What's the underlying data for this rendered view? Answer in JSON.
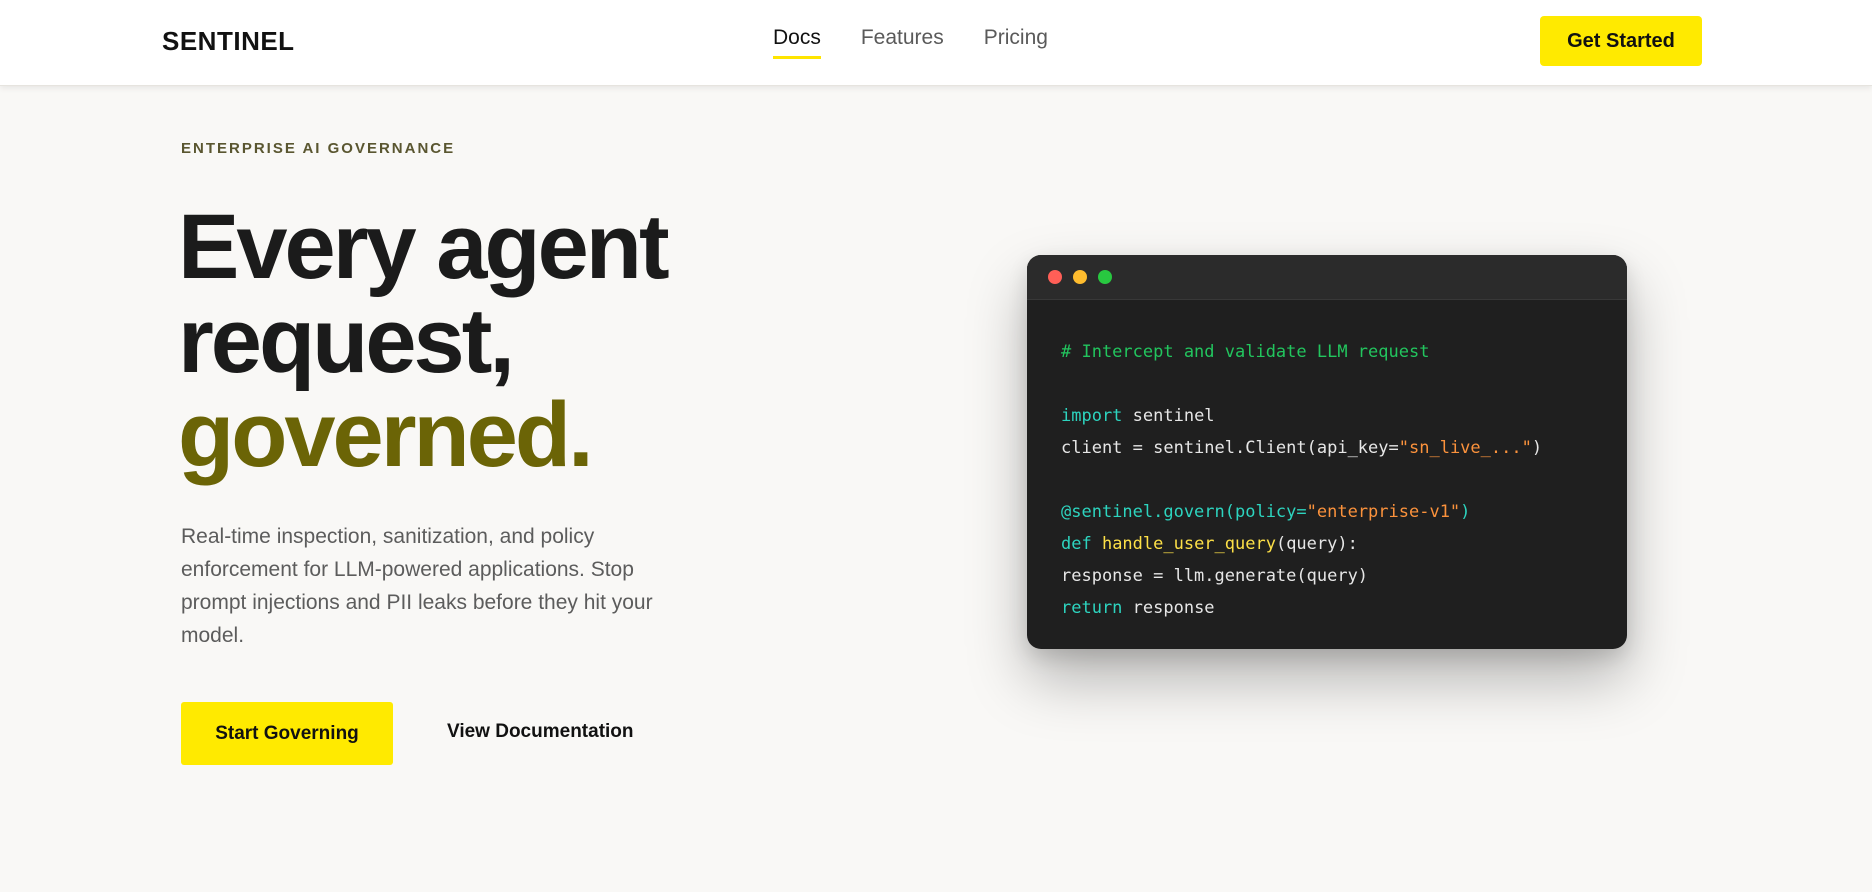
{
  "nav": {
    "brand": "SENTINEL",
    "links": [
      "Docs",
      "Features",
      "Pricing"
    ],
    "cta": "Get Started"
  },
  "hero": {
    "eyebrow": "ENTERPRISE AI GOVERNANCE",
    "headline_line1": "Every agent",
    "headline_line2": "request,",
    "headline_accent": "governed.",
    "subcopy": "Real-time inspection, sanitization, and policy enforcement for LLM-powered applications. Stop prompt injections and PII leaks before they hit your model.",
    "primary_button": "Start Governing",
    "secondary_link": "View Documentation"
  },
  "code": {
    "comment": "# Intercept and validate LLM request",
    "import_kw": "import",
    "import_mod": " sentinel",
    "client_pre": "client = sentinel.Client(api_key=",
    "client_str": "\"sn_live_...\"",
    "client_post": ")",
    "decorator_pre": "@sentinel.govern(policy=",
    "decorator_str": "\"enterprise-v1\"",
    "decorator_post": ")",
    "def_kw": "def",
    "def_name": " handle_user_query",
    "def_args": "(query):",
    "response_line": "response = llm.generate(query)",
    "return_kw": "return",
    "return_val": " response"
  },
  "colors": {
    "accent_yellow": "#ffea00",
    "headline_accent": "#6b6406",
    "code_bg": "#1f1f1f"
  }
}
